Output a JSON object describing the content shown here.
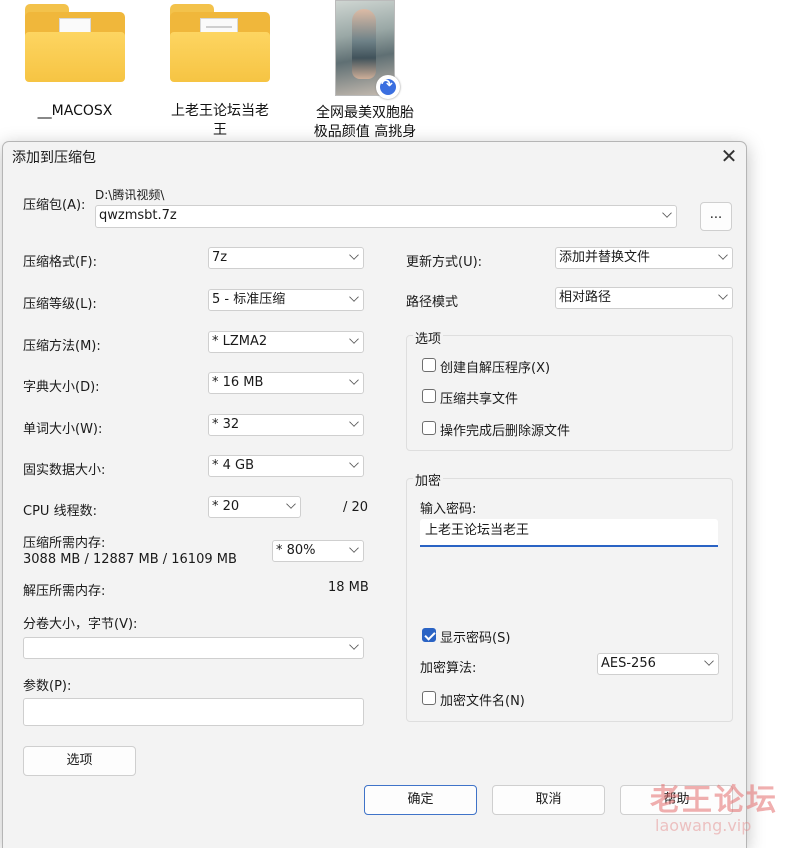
{
  "desktop": {
    "items": [
      {
        "label": "__MACOSX",
        "type": "folder"
      },
      {
        "label": "上老王论坛当老王",
        "type": "folder-doc"
      },
      {
        "label": "全网最美双胞胎极品颜值 高挑身",
        "type": "image-shortcut"
      }
    ]
  },
  "dialog": {
    "title": "添加到压缩包",
    "archive_label": "压缩包(A):",
    "archive_path": "D:\\腾讯视频\\",
    "archive_name": "qwzmsbt.7z",
    "browse_label": "...",
    "left": {
      "format_label": "压缩格式(F):",
      "format_value": "7z",
      "level_label": "压缩等级(L):",
      "level_value": "5 - 标准压缩",
      "method_label": "压缩方法(M):",
      "method_value": "*  LZMA2",
      "dict_label": "字典大小(D):",
      "dict_value": "*  16 MB",
      "word_label": "单词大小(W):",
      "word_value": "*  32",
      "solid_label": "固实数据大小:",
      "solid_value": "*  4 GB",
      "cpu_label": "CPU 线程数:",
      "cpu_value": "*  20",
      "cpu_total": "/ 20",
      "mem_label": "压缩所需内存:",
      "mem_detail": "3088 MB / 12887 MB / 16109 MB",
      "mem_value": "*  80%",
      "unpack_label": "解压所需内存:",
      "unpack_value": "18 MB",
      "split_label": "分卷大小，字节(V):",
      "split_value": "",
      "params_label": "参数(P):",
      "params_value": "",
      "options_button": "选项"
    },
    "right": {
      "update_label": "更新方式(U):",
      "update_value": "添加并替换文件",
      "path_label": "路径模式",
      "path_value": "相对路径",
      "options_group": "选项",
      "opt_sfx": "创建自解压程序(X)",
      "opt_shared": "压缩共享文件",
      "opt_delete": "操作完成后删除源文件",
      "encrypt_group": "加密",
      "password_label": "输入密码:",
      "password_value": "上老王论坛当老王",
      "show_password": "显示密码(S)",
      "enc_method_label": "加密算法:",
      "enc_method_value": "AES-256",
      "encrypt_names": "加密文件名(N)"
    },
    "buttons": {
      "ok": "确定",
      "cancel": "取消",
      "help": "帮助"
    }
  },
  "watermark": {
    "cn": "老王论坛",
    "en": "laowang.vip"
  }
}
